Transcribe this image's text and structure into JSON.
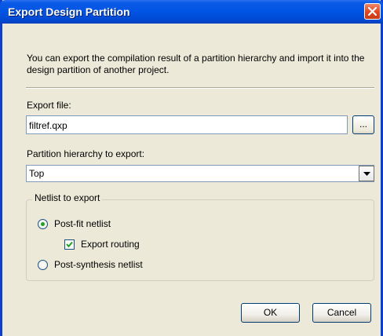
{
  "window": {
    "title": "Export Design Partition"
  },
  "description": "You can export the compilation result of a partition hierarchy and import it into the design partition of another project.",
  "export_file": {
    "label": "Export file:",
    "value": "filtref.qxp",
    "browse_label": "..."
  },
  "partition": {
    "label": "Partition hierarchy to export:",
    "selected": "Top"
  },
  "netlist": {
    "group_label": "Netlist to export",
    "options": [
      {
        "label": "Post-fit netlist",
        "selected": true
      },
      {
        "label": "Post-synthesis netlist",
        "selected": false
      }
    ],
    "export_routing": {
      "label": "Export routing",
      "checked": true
    }
  },
  "buttons": {
    "ok": "OK",
    "cancel": "Cancel"
  },
  "colors": {
    "titlebar": "#0054e3",
    "close": "#e0461c",
    "dialog_bg": "#ece9d8",
    "radio_dot": "#21a121"
  },
  "icons": {
    "close": "close-x-icon",
    "dropdown": "chevron-down-icon",
    "check": "checkmark-icon"
  }
}
